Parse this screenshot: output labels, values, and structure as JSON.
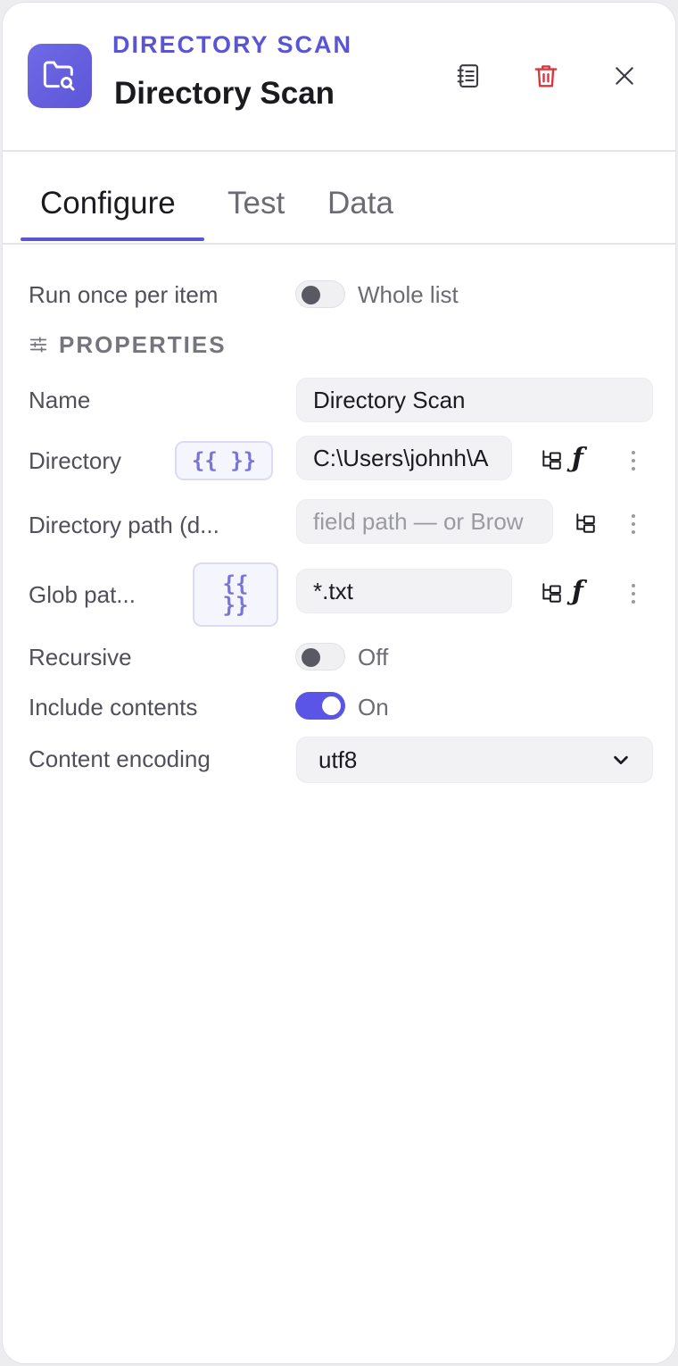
{
  "header": {
    "kicker": "DIRECTORY SCAN",
    "title": "Directory Scan",
    "icons": {
      "app": "folder-search-icon",
      "notes": "notebook-icon",
      "delete": "trash-icon",
      "close": "close-icon"
    }
  },
  "tabs": [
    {
      "label": "Configure",
      "active": true
    },
    {
      "label": "Test",
      "active": false
    },
    {
      "label": "Data",
      "active": false
    }
  ],
  "run_once": {
    "label": "Run once per item",
    "toggle_text": "Whole list",
    "on": false
  },
  "properties": {
    "section_title": "PROPERTIES",
    "name": {
      "label": "Name",
      "value": "Directory Scan"
    },
    "directory": {
      "label": "Directory",
      "expr_badge": "{{ }}",
      "value": "C:\\Users\\johnh\\A"
    },
    "directory_path": {
      "label": "Directory path (d...",
      "placeholder": "field path — or Brow"
    },
    "glob": {
      "label": "Glob pat...",
      "expr_badge_line1": "{{",
      "expr_badge_line2": "}}",
      "value": "*.txt"
    },
    "recursive": {
      "label": "Recursive",
      "toggle_text": "Off",
      "on": false
    },
    "include_contents": {
      "label": "Include contents",
      "toggle_text": "On",
      "on": true
    },
    "content_encoding": {
      "label": "Content encoding",
      "value": "utf8"
    }
  },
  "function_glyph": "ƒ",
  "colors": {
    "accent": "#5a55d4",
    "delete": "#d9363e",
    "toggle_on": "#5a55e6"
  }
}
